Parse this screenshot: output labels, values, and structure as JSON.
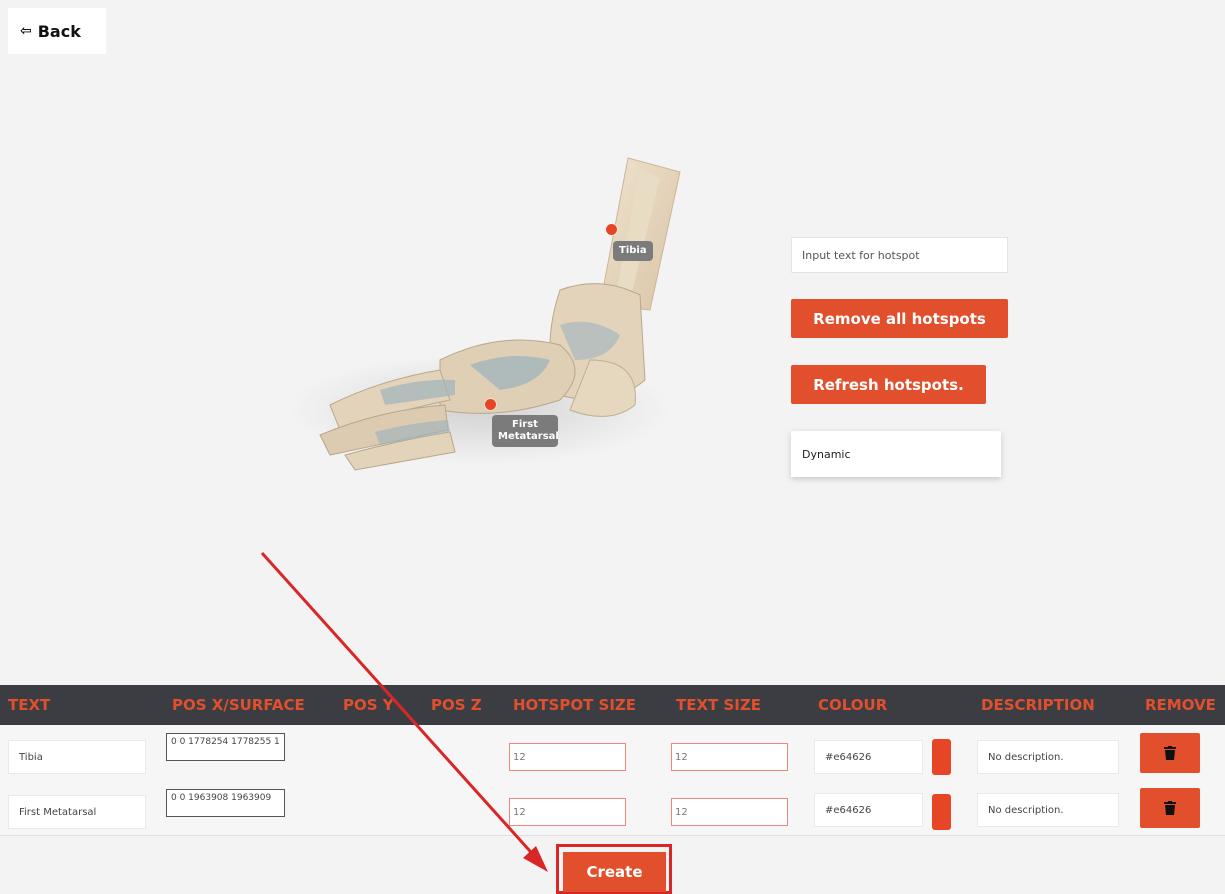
{
  "header": {
    "back_label": "Back"
  },
  "viewer": {
    "hotspots": [
      {
        "label": "Tibia"
      },
      {
        "label": "First Metatarsal"
      }
    ]
  },
  "side_panel": {
    "hotspot_input_placeholder": "Input text for hotspot",
    "remove_all_label": "Remove all hotspots",
    "refresh_label": "Refresh hotspots.",
    "mode_label": "Dynamic"
  },
  "table": {
    "columns": [
      "TEXT",
      "POS X/SURFACE",
      "POS Y",
      "POS Z",
      "HOTSPOT SIZE",
      "TEXT SIZE",
      "COLOUR",
      "DESCRIPTION",
      "REMOVE"
    ],
    "rows": [
      {
        "text": "Tibia",
        "pos_surface": "0 0 1778254 1778255 1",
        "hotspot_size": "12",
        "text_size": "12",
        "colour": "#e64626",
        "description": "No description."
      },
      {
        "text": "First Metatarsal",
        "pos_surface": "0 0 1963908 1963909",
        "hotspot_size": "12",
        "text_size": "12",
        "colour": "#e64626",
        "description": "No description."
      }
    ]
  },
  "footer": {
    "create_label": "Create"
  },
  "colors": {
    "accent": "#e14f2c",
    "header_bg": "#3c3d42",
    "annotation_red": "#d92626",
    "hotspot": "#e64626"
  },
  "icons": {
    "back": "back-arrow-icon",
    "remove": "trash-icon"
  }
}
